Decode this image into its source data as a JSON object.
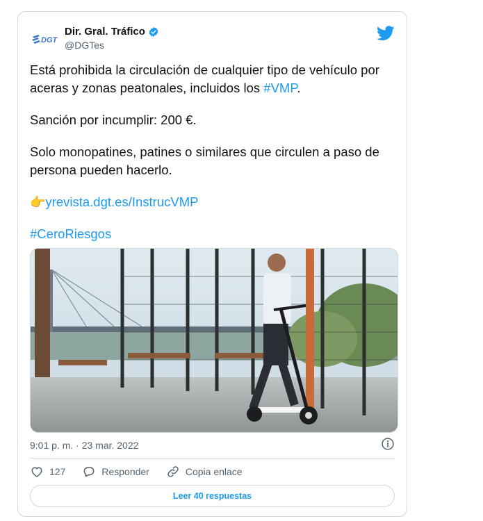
{
  "colors": {
    "accent": "#1d9bf0",
    "text": "#0f1419",
    "muted": "#536471",
    "border": "#cfd9de",
    "dgt_blue": "#3a78c8"
  },
  "tweet": {
    "author_name": "Dir. Gral. Tráfico",
    "author_handle": "@DGTes",
    "logo_text": "DGT",
    "paragraph1_a": "Está prohibida la circulación de cualquier tipo de vehículo por aceras y zonas peatonales, incluidos los ",
    "paragraph1_hashtag": "#VMP",
    "paragraph1_b": ".",
    "paragraph2": "Sanción por incumplir: 200 €.",
    "paragraph3": "Solo monopatines, patines o similares que circulen a paso de persona pueden hacerlo.",
    "pointer_emoji": "👉",
    "link": "yrevista.dgt.es/InstrucVMP",
    "hashtag2": "#CeroRiesgos",
    "timestamp": "9:01 p. m. · 23 mar. 2022"
  },
  "icons": {
    "verified": "verified-badge-icon",
    "bird": "twitter-bird-icon",
    "info": "info-icon",
    "heart": "heart-icon",
    "reply": "reply-icon",
    "link": "copy-link-icon"
  },
  "actions": {
    "like_count": "127",
    "reply_label": "Responder",
    "copy_label": "Copia enlace"
  },
  "read_replies_label": "Leer 40 respuestas"
}
